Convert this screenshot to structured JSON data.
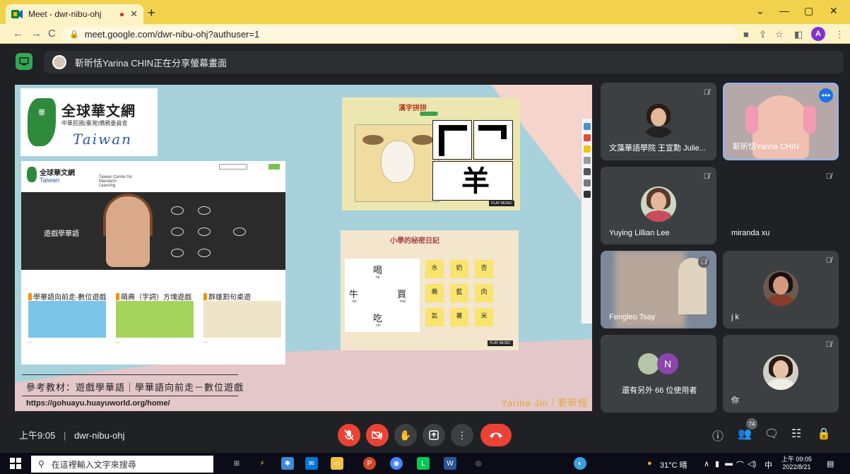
{
  "browser": {
    "tab_title": "Meet - dwr-nibu-ohj",
    "url": "meet.google.com/dwr-nibu-ohj?authuser=1",
    "profile_initial": "A",
    "new_tab": "+",
    "close_tab": "✕",
    "rec_dot": "●",
    "win_min": "—",
    "win_max": "▢",
    "win_close": "✕",
    "win_chev": "⌄"
  },
  "meet": {
    "share_banner": "靳昕恬Yarina CHIN正在分享螢幕畫面",
    "time": "上午9:05",
    "separator": "|",
    "meeting_code": "dwr-nibu-ohj",
    "participant_count": "74"
  },
  "presentation": {
    "logo_title": "全球華文網",
    "logo_sub": "中華民國(臺灣)僑務委員會",
    "logo_brand": "Taiwan",
    "seal_text": "華",
    "site_title": "全球華文網",
    "site_brand": "Taiwan",
    "site_center": "Taiwan Center for Mandarin Learning",
    "hero_label": "遊戲學華語",
    "section1": "學華語向前走-數位遊戲",
    "section2": "萌典（字詞）方塊遊戲",
    "section3": "群雄割句桌遊",
    "ref_text": "參考教材：遊戲學華語｜學華語向前走－數位遊戲",
    "ref_url": "https://gohuayu.huayuworld.org/home/",
    "signature": "Yarina Jin｜靳昕恬",
    "game1_title": "漢字拼拼",
    "game2_title": "小學的秘密日記",
    "music_label": "PLAY MUSIC",
    "game2_chars": [
      {
        "ch": "喝",
        "py": "hē"
      },
      {
        "ch": "牛",
        "py": "niú"
      },
      {
        "ch": "買",
        "py": "mǎi"
      },
      {
        "ch": "吃",
        "py": "chī"
      }
    ],
    "game2_notes": [
      "水",
      "奶",
      "杏",
      "蕎",
      "藍",
      "肉",
      "氣",
      "薯",
      "米"
    ]
  },
  "participants": [
    {
      "name": "文藻華語學院 王宣勳 Julie...",
      "muted": true
    },
    {
      "name": "靳昕恬Yarina CHIN",
      "muted": false
    },
    {
      "name": "Yuying Lillian Lee",
      "muted": true
    },
    {
      "name": "miranda xu",
      "muted": true
    },
    {
      "name": "Fengleo Tsay",
      "muted": true
    },
    {
      "name": "j k",
      "muted": true
    },
    {
      "name": "還有另外 66 位使用者",
      "muted": false
    },
    {
      "name": "你",
      "muted": true
    }
  ],
  "others_initial": "N",
  "taskbar": {
    "search_placeholder": "在這裡輸入文字來搜尋",
    "weather": "31°C 晴",
    "ime": "中",
    "time": "上午 09:05",
    "date": "2022/8/21"
  },
  "colors": {
    "meet_bg": "#202124",
    "tile_bg": "#3c4043",
    "red": "#ea4335",
    "tab_bar": "#f2d24c"
  }
}
